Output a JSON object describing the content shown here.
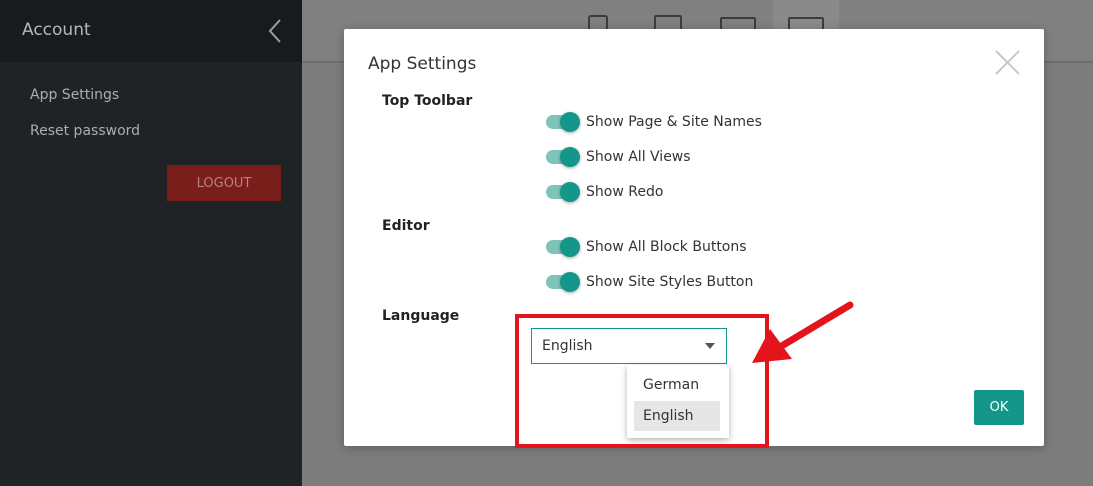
{
  "sidebar": {
    "title": "Account",
    "items": [
      {
        "label": "App Settings"
      },
      {
        "label": "Reset password"
      }
    ],
    "logout_label": "LOGOUT",
    "back_icon": "chevron-left-icon"
  },
  "workspace": {
    "view_buttons": [
      {
        "icon": "mobile-view-icon"
      },
      {
        "icon": "tablet-view-icon"
      },
      {
        "icon": "tablet-landscape-view-icon"
      },
      {
        "icon": "desktop-view-icon",
        "active": true
      }
    ]
  },
  "modal": {
    "title": "App Settings",
    "close_icon": "close-icon",
    "sections": {
      "top_toolbar": {
        "label": "Top Toolbar",
        "toggles": [
          {
            "label": "Show Page & Site Names",
            "on": true
          },
          {
            "label": "Show All Views",
            "on": true
          },
          {
            "label": "Show Redo",
            "on": true
          }
        ]
      },
      "editor": {
        "label": "Editor",
        "toggles": [
          {
            "label": "Show All Block Buttons",
            "on": true
          },
          {
            "label": "Show Site Styles Button",
            "on": true
          }
        ]
      },
      "language": {
        "label": "Language",
        "selected": "English",
        "options": [
          "German",
          "English"
        ]
      }
    },
    "ok_label": "OK"
  },
  "colors": {
    "accent": "#14968a",
    "toggle_track": "#7fc4bb",
    "sidebar_bg": "#1f2325",
    "logout_bg": "#7a1e1c",
    "highlight": "#e3141b"
  }
}
